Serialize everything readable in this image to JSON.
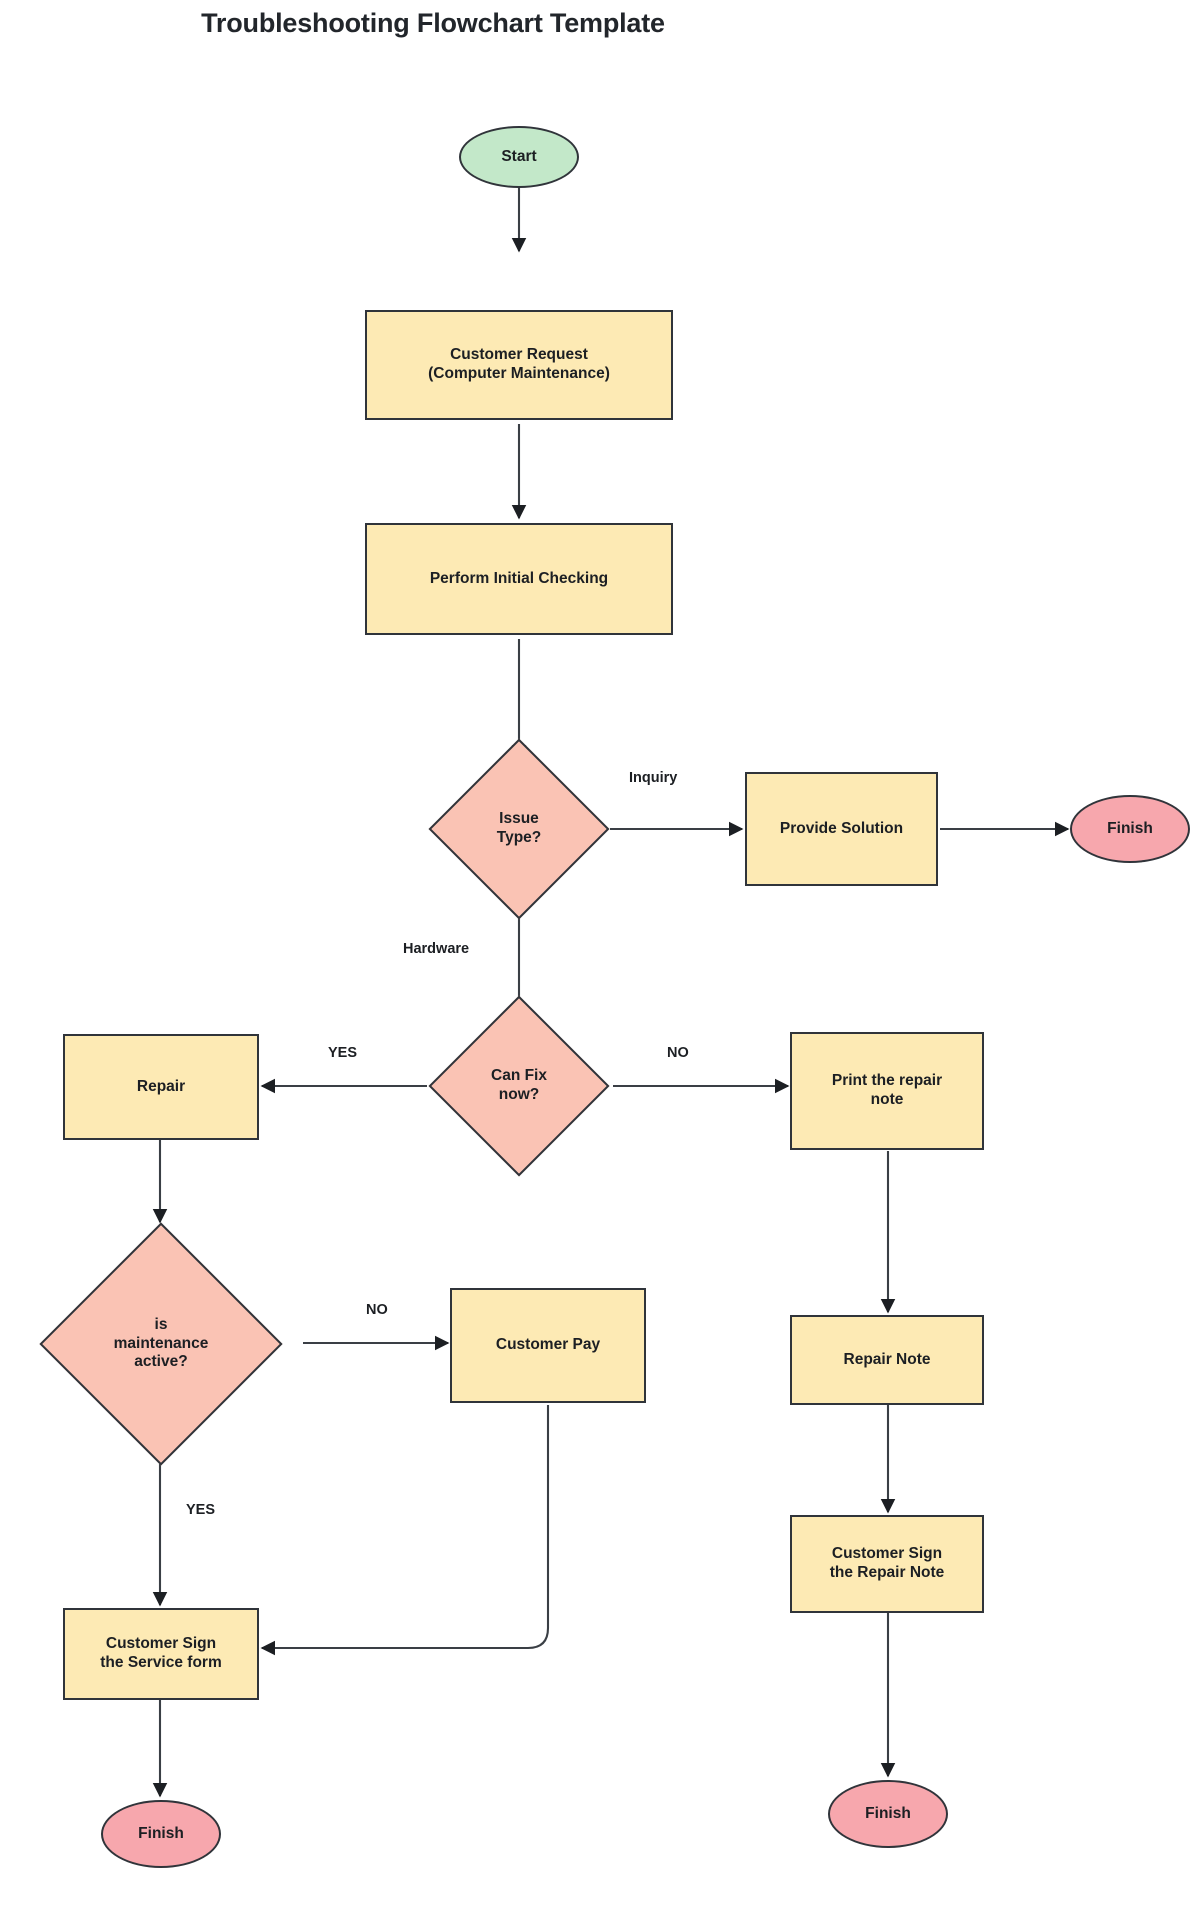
{
  "page": {
    "title": "Troubleshooting Flowchart Template",
    "background": "#ffffff"
  },
  "palette": {
    "process_fill": "#fdeab4",
    "decision_fill": "#fac3b4",
    "start_fill": "#c3e8c9",
    "finish_fill": "#f7a7ad",
    "stroke": "#30343a",
    "text": "#1c1f23"
  },
  "nodes": {
    "start": {
      "label": "Start",
      "shape": "ellipse",
      "type": "terminal-start"
    },
    "customer_request": {
      "label": "Customer Request\n(Computer Maintenance)",
      "line1": "Customer Request",
      "line2": "(Computer Maintenance)",
      "shape": "rectangle",
      "type": "process"
    },
    "initial_checking": {
      "label": "Perform Initial Checking",
      "shape": "rectangle",
      "type": "process"
    },
    "issue_type": {
      "label": "Issue Type?",
      "line1": "Issue",
      "line2": "Type?",
      "shape": "diamond",
      "type": "decision"
    },
    "provide_solution": {
      "label": "Provide Solution",
      "shape": "rectangle",
      "type": "process"
    },
    "finish_inquiry": {
      "label": "Finish",
      "shape": "ellipse",
      "type": "terminal-end"
    },
    "can_fix_now": {
      "label": "Can Fix now?",
      "line1": "Can Fix",
      "line2": "now?",
      "shape": "diamond",
      "type": "decision"
    },
    "repair": {
      "label": "Repair",
      "shape": "rectangle",
      "type": "process"
    },
    "print_repair_note": {
      "label": "Print the repair note",
      "line1": "Print the repair",
      "line2": "note",
      "shape": "rectangle",
      "type": "process"
    },
    "maintenance_active": {
      "label": "is maintenance active?",
      "line1": "is",
      "line2": "maintenance",
      "line3": "active?",
      "shape": "diamond",
      "type": "decision"
    },
    "customer_pay": {
      "label": "Customer Pay",
      "shape": "rectangle",
      "type": "process"
    },
    "repair_note": {
      "label": "Repair Note",
      "shape": "rectangle",
      "type": "process"
    },
    "customer_sign_service_form": {
      "label": "Customer Sign the Service form",
      "line1": "Customer Sign",
      "line2": "the Service form",
      "shape": "rectangle",
      "type": "process"
    },
    "customer_sign_repair_note": {
      "label": "Customer Sign the Repair Note",
      "line1": "Customer Sign",
      "line2": "the Repair Note",
      "shape": "rectangle",
      "type": "process"
    },
    "finish_service": {
      "label": "Finish",
      "shape": "ellipse",
      "type": "terminal-end"
    },
    "finish_repair": {
      "label": "Finish",
      "shape": "ellipse",
      "type": "terminal-end"
    }
  },
  "edge_labels": {
    "inquiry": "Inquiry",
    "hardware": "Hardware",
    "can_fix_yes": "YES",
    "can_fix_no": "NO",
    "maintenance_no": "NO",
    "maintenance_yes": "YES"
  },
  "edges": [
    {
      "from": "start",
      "to": "customer_request",
      "label": ""
    },
    {
      "from": "customer_request",
      "to": "initial_checking",
      "label": ""
    },
    {
      "from": "initial_checking",
      "to": "issue_type",
      "label": ""
    },
    {
      "from": "issue_type",
      "to": "provide_solution",
      "label": "Inquiry"
    },
    {
      "from": "provide_solution",
      "to": "finish_inquiry",
      "label": ""
    },
    {
      "from": "issue_type",
      "to": "can_fix_now",
      "label": "Hardware"
    },
    {
      "from": "can_fix_now",
      "to": "repair",
      "label": "YES"
    },
    {
      "from": "can_fix_now",
      "to": "print_repair_note",
      "label": "NO"
    },
    {
      "from": "repair",
      "to": "maintenance_active",
      "label": ""
    },
    {
      "from": "maintenance_active",
      "to": "customer_pay",
      "label": "NO"
    },
    {
      "from": "maintenance_active",
      "to": "customer_sign_service_form",
      "label": "YES"
    },
    {
      "from": "customer_pay",
      "to": "customer_sign_service_form",
      "label": ""
    },
    {
      "from": "customer_sign_service_form",
      "to": "finish_service",
      "label": ""
    },
    {
      "from": "print_repair_note",
      "to": "repair_note",
      "label": ""
    },
    {
      "from": "repair_note",
      "to": "customer_sign_repair_note",
      "label": ""
    },
    {
      "from": "customer_sign_repair_note",
      "to": "finish_repair",
      "label": ""
    }
  ]
}
